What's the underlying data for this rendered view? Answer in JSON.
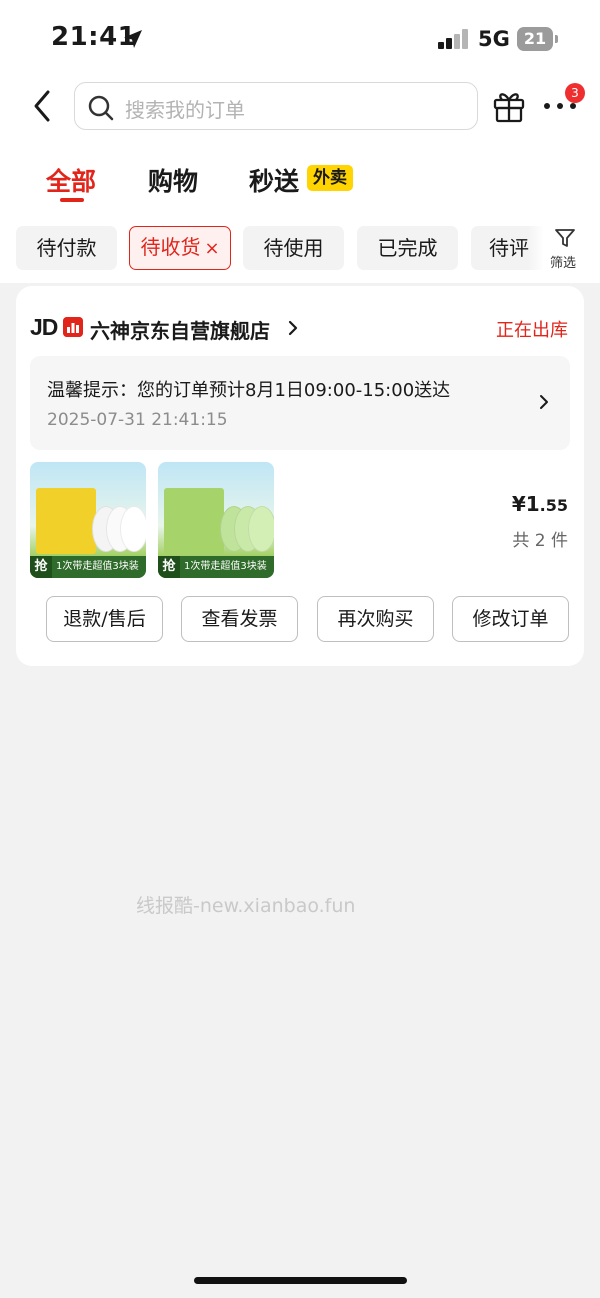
{
  "status_bar": {
    "time": "21:41",
    "network": "5G",
    "battery": "21"
  },
  "search": {
    "placeholder": "搜索我的订单",
    "notification_count": "3"
  },
  "tabs": [
    {
      "label": "全部",
      "active": true
    },
    {
      "label": "购物",
      "active": false
    },
    {
      "label": "秒送",
      "active": false,
      "tag": "外卖"
    }
  ],
  "filters": {
    "chips": [
      {
        "label": "待付款"
      },
      {
        "label": "待收货",
        "active": true,
        "close": "×"
      },
      {
        "label": "待使用"
      },
      {
        "label": "已完成"
      },
      {
        "label": "待评"
      }
    ],
    "filter_label": "筛选"
  },
  "order": {
    "platform": "JD",
    "store_name": "六神京东自营旗舰店",
    "status": "正在出库",
    "tip": "温馨提示：您的订单预计8月1日09:00-15:00送达",
    "time": "2025-07-31 21:41:15",
    "products": [
      {
        "badge": "抢",
        "caption": "1次带走超值3块装",
        "color": "#f2d02a"
      },
      {
        "badge": "抢",
        "caption": "1次带走超值3块装",
        "color": "#a6d36a"
      }
    ],
    "price_symbol": "¥",
    "price_int": "1",
    "price_dec": ".55",
    "quantity": "共 2 件",
    "buttons": [
      "退款/售后",
      "查看发票",
      "再次购买",
      "修改订单"
    ]
  },
  "watermark": "线报酷-new.xianbao.fun",
  "colors": {
    "accent": "#e1251b",
    "tag_yellow": "#ffd400",
    "background": "#f2f2f2"
  }
}
